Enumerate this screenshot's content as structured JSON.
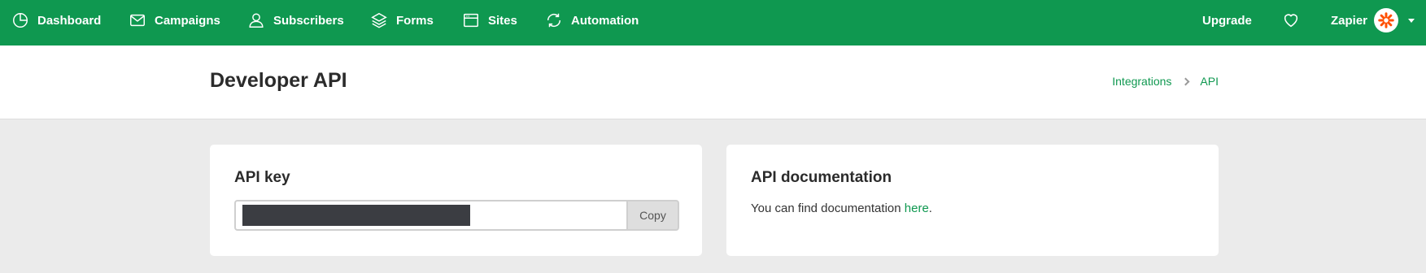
{
  "nav": {
    "items": [
      {
        "label": "Dashboard",
        "icon": "dashboard-icon"
      },
      {
        "label": "Campaigns",
        "icon": "mail-icon"
      },
      {
        "label": "Subscribers",
        "icon": "user-icon"
      },
      {
        "label": "Forms",
        "icon": "layers-icon"
      },
      {
        "label": "Sites",
        "icon": "browser-icon"
      },
      {
        "label": "Automation",
        "icon": "refresh-icon"
      }
    ],
    "upgrade_label": "Upgrade",
    "heart_icon": "heart-icon",
    "account_name": "Zapier",
    "account_icon": "zapier-logo-icon"
  },
  "header": {
    "title": "Developer API",
    "breadcrumb": [
      "Integrations",
      "API"
    ]
  },
  "api_key_card": {
    "title": "API key",
    "key_value": "",
    "copy_label": "Copy"
  },
  "docs_card": {
    "title": "API documentation",
    "text_before": "You can find documentation ",
    "link_text": "here",
    "text_after": "."
  },
  "colors": {
    "brand_green": "#0f9850",
    "masked_key": "#3b3d42",
    "page_background": "#ebebeb",
    "zapier_orange": "#ff4f00"
  }
}
